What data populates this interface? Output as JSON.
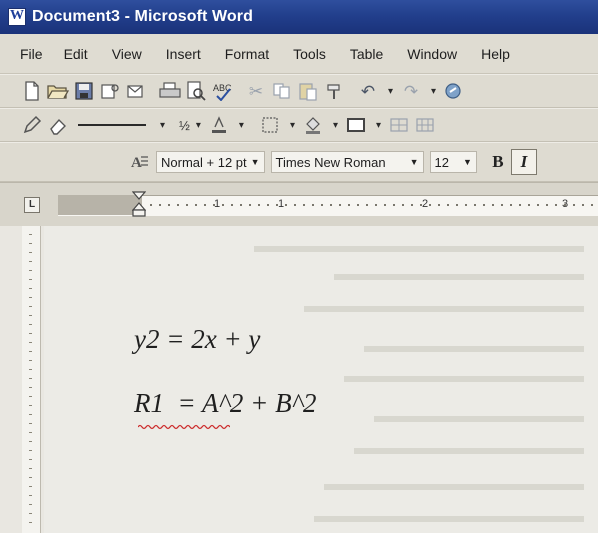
{
  "window": {
    "title": "Document3 - Microsoft Word"
  },
  "menu": [
    "File",
    "Edit",
    "View",
    "Insert",
    "Format",
    "Tools",
    "Table",
    "Window",
    "Help"
  ],
  "toolbar_standard": {
    "icons": [
      "new-document-icon",
      "open-folder-icon",
      "save-icon",
      "permission-icon",
      "email-icon",
      "print-icon",
      "print-preview-icon",
      "spelling-icon",
      "cut-icon",
      "copy-icon",
      "paste-icon",
      "format-painter-icon",
      "undo-icon",
      "redo-icon",
      "hyperlink-icon"
    ]
  },
  "toolbar_drawing": {
    "line_weight": "½",
    "icons": [
      "pencil-icon",
      "eraser-icon",
      "line-style-icon",
      "font-color-icon",
      "border-icon",
      "shading-color-icon",
      "outside-border-icon"
    ]
  },
  "toolbar_formatting": {
    "style": "Normal + 12 pt",
    "font": "Times New Roman",
    "size": "12",
    "bold_label": "B",
    "italic_label": "I",
    "italic_active": true
  },
  "ruler": {
    "corner_label": "L",
    "numbers": [
      "1",
      "1",
      "2",
      "3"
    ]
  },
  "document": {
    "lines": [
      "y2 = 2x + y",
      "R1  = A^2 + B^2"
    ]
  },
  "colors": {
    "titlebar": "#223f8c",
    "text": "#1f1f1f",
    "spellcheck": "#cc2b2b"
  }
}
